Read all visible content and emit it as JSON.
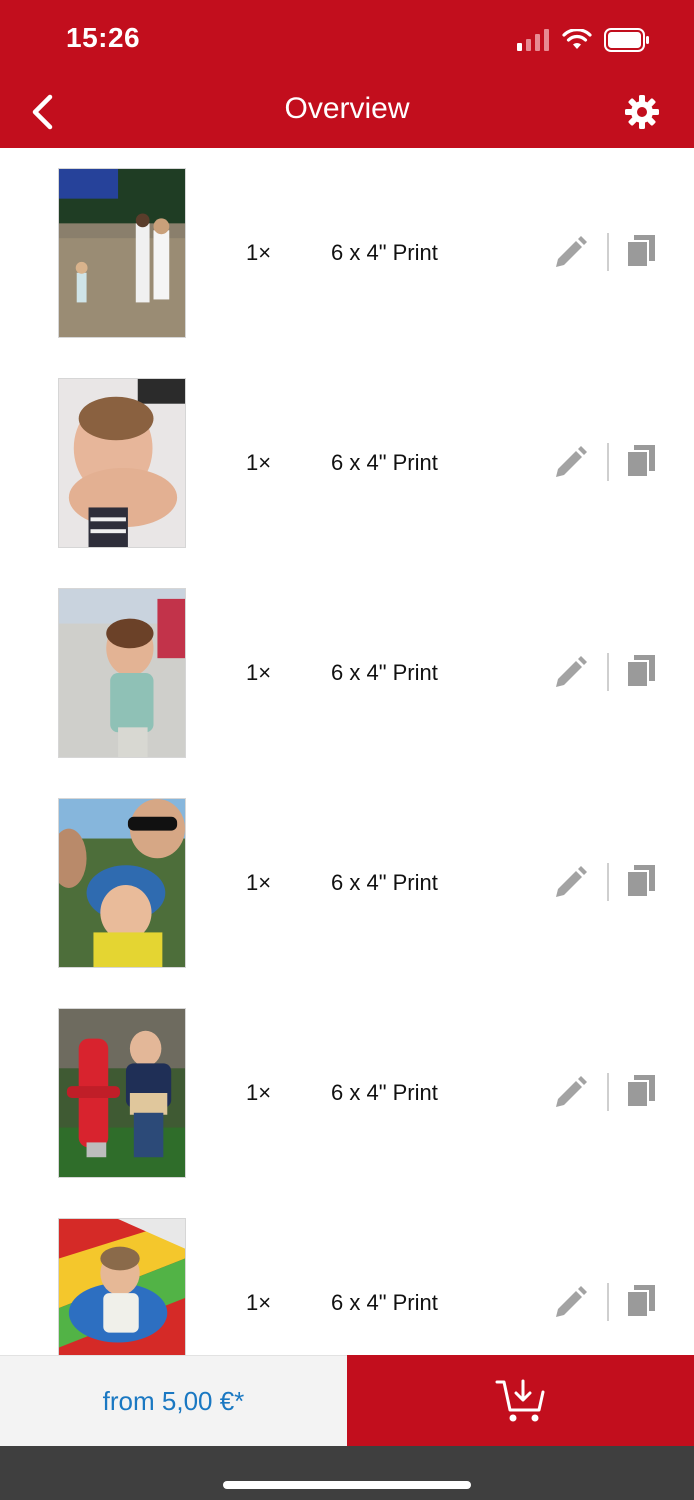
{
  "status_bar": {
    "time": "15:26"
  },
  "header": {
    "title": "Overview"
  },
  "items": [
    {
      "quantity": "1×",
      "product": "6 x 4\" Print"
    },
    {
      "quantity": "1×",
      "product": "6 x 4\" Print"
    },
    {
      "quantity": "1×",
      "product": "6 x 4\" Print"
    },
    {
      "quantity": "1×",
      "product": "6 x 4\" Print"
    },
    {
      "quantity": "1×",
      "product": "6 x 4\" Print"
    },
    {
      "quantity": "1×",
      "product": "6 x 4\" Print"
    }
  ],
  "footer": {
    "price": "from 5,00 €*"
  },
  "icons": {
    "back": "chevron-left-icon",
    "settings": "gear-icon",
    "edit": "pencil-icon",
    "copy": "copy-icon",
    "cart": "cart-download-icon"
  },
  "colors": {
    "brand_red": "#c20e1d",
    "price_blue": "#1a78c2",
    "icon_gray": "#9a9a9a"
  }
}
